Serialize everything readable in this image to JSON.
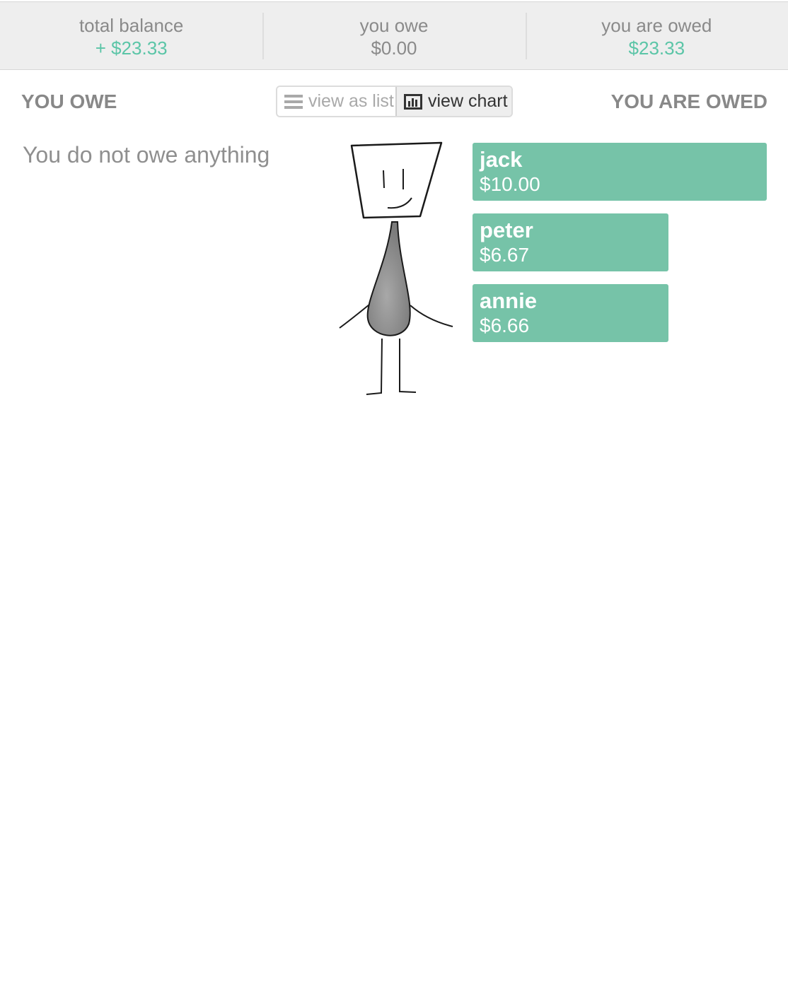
{
  "summary": {
    "total_balance_label": "total balance",
    "total_balance_value": "+ $23.33",
    "you_owe_label": "you owe",
    "you_owe_value": "$0.00",
    "you_are_owed_label": "you are owed",
    "you_are_owed_value": "$23.33"
  },
  "left_heading": "YOU OWE",
  "right_heading": "YOU ARE OWED",
  "toggle": {
    "list_label": "view as list",
    "chart_label": "view chart",
    "selected": "view chart"
  },
  "empty_message": "You do not owe anything",
  "colors": {
    "accent_green": "#5bc5a7",
    "bar_green": "#76c3a8"
  },
  "chart_data": {
    "type": "bar",
    "categories": [
      "jack",
      "peter",
      "annie"
    ],
    "values": [
      10.0,
      6.67,
      6.66
    ],
    "value_labels": [
      "$10.00",
      "$6.67",
      "$6.66"
    ]
  }
}
